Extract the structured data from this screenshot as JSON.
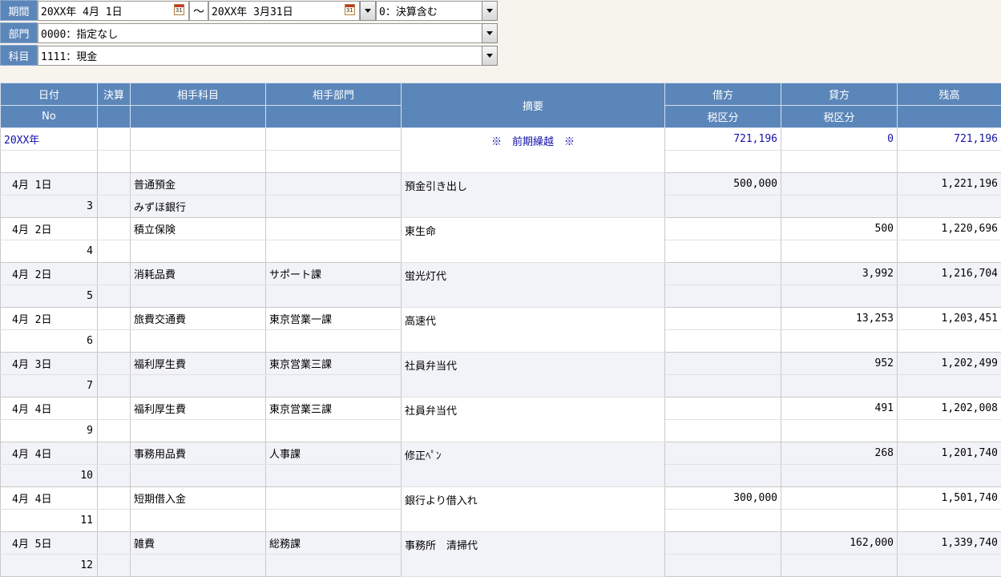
{
  "filters": {
    "period_label": "期間",
    "date_from": "20XX年 4月 1日",
    "tilde": "～",
    "date_to": "20XX年 3月31日",
    "settlement": "0：決算含む",
    "dept_label": "部門",
    "dept_value": "0000：指定なし",
    "account_label": "科目",
    "account_value": "1111：現金",
    "calendar_glyph": "31"
  },
  "columns": {
    "date": "日付",
    "settle": "決算",
    "partner_account": "相手科目",
    "partner_dept": "相手部門",
    "memo": "摘要",
    "debit": "借方",
    "credit": "貸方",
    "balance": "残高",
    "no": "No",
    "tax_debit": "税区分",
    "tax_credit": "税区分"
  },
  "carry_forward": {
    "year": "20XX年",
    "memo": "※　前期繰越　※",
    "debit": "721,196",
    "credit": "0",
    "balance": "721,196"
  },
  "rows": [
    {
      "date": "4月 1日",
      "no": "3",
      "account": "普通預金",
      "account_sub": "みずほ銀行",
      "dept": "",
      "memo": "預金引き出し",
      "debit": "500,000",
      "credit": "",
      "balance": "1,221,196"
    },
    {
      "date": "4月 2日",
      "no": "4",
      "account": "積立保険",
      "account_sub": "",
      "dept": "",
      "memo": "東生命",
      "debit": "",
      "credit": "500",
      "balance": "1,220,696"
    },
    {
      "date": "4月 2日",
      "no": "5",
      "account": "消耗品費",
      "account_sub": "",
      "dept": "サポート課",
      "memo": "蛍光灯代",
      "debit": "",
      "credit": "3,992",
      "balance": "1,216,704"
    },
    {
      "date": "4月 2日",
      "no": "6",
      "account": "旅費交通費",
      "account_sub": "",
      "dept": "東京営業一課",
      "memo": "高速代",
      "debit": "",
      "credit": "13,253",
      "balance": "1,203,451"
    },
    {
      "date": "4月 3日",
      "no": "7",
      "account": "福利厚生費",
      "account_sub": "",
      "dept": "東京営業三課",
      "memo": "社員弁当代",
      "debit": "",
      "credit": "952",
      "balance": "1,202,499"
    },
    {
      "date": "4月 4日",
      "no": "9",
      "account": "福利厚生費",
      "account_sub": "",
      "dept": "東京営業三課",
      "memo": "社員弁当代",
      "debit": "",
      "credit": "491",
      "balance": "1,202,008"
    },
    {
      "date": "4月 4日",
      "no": "10",
      "account": "事務用品費",
      "account_sub": "",
      "dept": "人事課",
      "memo": "修正ﾍﾟﾝ",
      "debit": "",
      "credit": "268",
      "balance": "1,201,740"
    },
    {
      "date": "4月 4日",
      "no": "11",
      "account": "短期借入金",
      "account_sub": "",
      "dept": "",
      "memo": "銀行より借入れ",
      "debit": "300,000",
      "credit": "",
      "balance": "1,501,740"
    },
    {
      "date": "4月 5日",
      "no": "12",
      "account": "雑費",
      "account_sub": "",
      "dept": "総務課",
      "memo": "事務所　清掃代",
      "debit": "",
      "credit": "162,000",
      "balance": "1,339,740"
    }
  ]
}
